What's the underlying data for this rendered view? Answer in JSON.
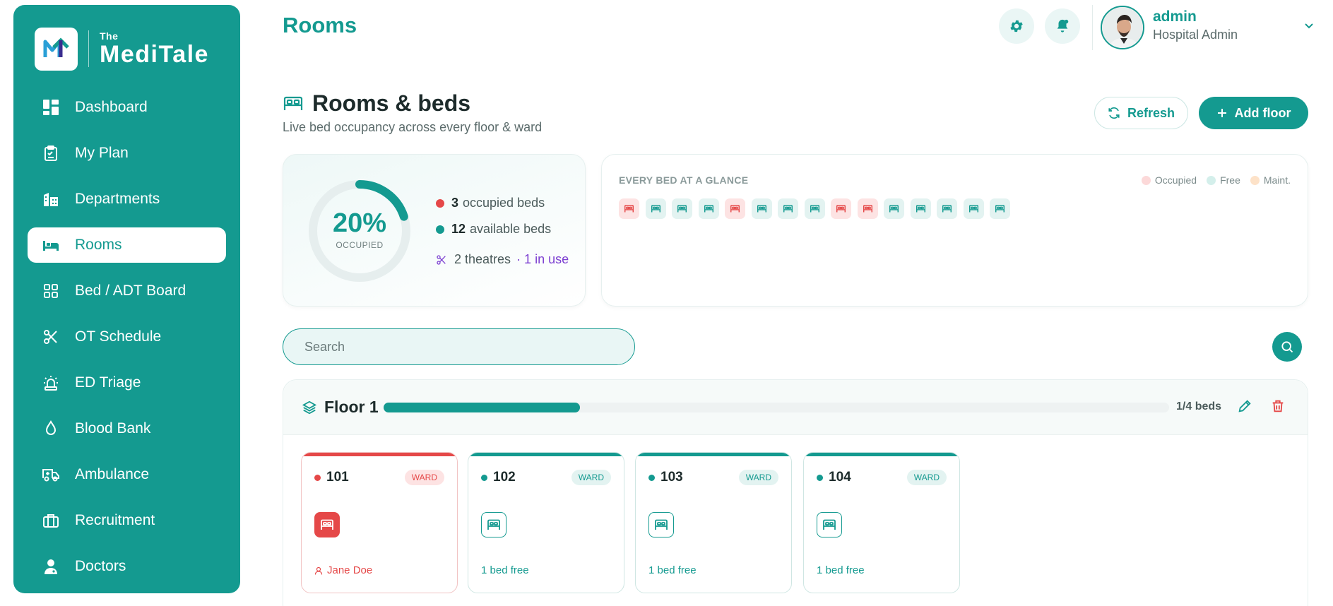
{
  "brand": {
    "the": "The",
    "name": "MediTale"
  },
  "nav": [
    {
      "label": "Dashboard",
      "icon": "dashboard-icon"
    },
    {
      "label": "My Plan",
      "icon": "clipboard-icon"
    },
    {
      "label": "Departments",
      "icon": "building-icon"
    },
    {
      "label": "Rooms",
      "icon": "bed-icon",
      "active": true
    },
    {
      "label": "Bed / ADT Board",
      "icon": "grid-icon"
    },
    {
      "label": "OT Schedule",
      "icon": "scissors-icon"
    },
    {
      "label": "ED Triage",
      "icon": "siren-icon"
    },
    {
      "label": "Blood Bank",
      "icon": "droplet-icon"
    },
    {
      "label": "Ambulance",
      "icon": "ambulance-icon"
    },
    {
      "label": "Recruitment",
      "icon": "briefcase-icon"
    },
    {
      "label": "Doctors",
      "icon": "doctor-icon"
    }
  ],
  "header": {
    "title": "Rooms"
  },
  "user": {
    "name": "admin",
    "role": "Hospital Admin"
  },
  "section": {
    "title": "Rooms & beds",
    "subtitle": "Live bed occupancy across every floor & ward"
  },
  "actions": {
    "refresh": "Refresh",
    "add_floor": "Add floor"
  },
  "stats": {
    "occupied_pct": "20%",
    "occupied_pct_value": 0.2,
    "occupied_label": "OCCUPIED",
    "occupied_count": "3",
    "occupied_text": "occupied beds",
    "available_count": "12",
    "available_text": "available beds",
    "theatres_text": "2 theatres",
    "theatres_in_use": "· 1 in use"
  },
  "glance": {
    "title": "EVERY BED AT A GLANCE",
    "legend": [
      {
        "label": "Occupied",
        "color": "#fcd9d9"
      },
      {
        "label": "Free",
        "color": "#d4efeb"
      },
      {
        "label": "Maint.",
        "color": "#fde2c8"
      }
    ],
    "beds": [
      "occupied",
      "free",
      "free",
      "free",
      "occupied",
      "free",
      "free",
      "free",
      "occupied",
      "occupied",
      "free",
      "free",
      "free",
      "free",
      "free"
    ]
  },
  "search": {
    "placeholder": "Search"
  },
  "floor": {
    "name": "Floor 1",
    "occupancy_fraction": 0.25,
    "count": "1/4 beds",
    "rooms": [
      {
        "number": "101",
        "type": "WARD",
        "status": "occupied",
        "footer": "Jane Doe"
      },
      {
        "number": "102",
        "type": "WARD",
        "status": "free",
        "footer": "1 bed free"
      },
      {
        "number": "103",
        "type": "WARD",
        "status": "free",
        "footer": "1 bed free"
      },
      {
        "number": "104",
        "type": "WARD",
        "status": "free",
        "footer": "1 bed free"
      }
    ]
  },
  "colors": {
    "primary": "#149a90",
    "occupied": "#e54848",
    "accent": "#7c3fd1"
  }
}
